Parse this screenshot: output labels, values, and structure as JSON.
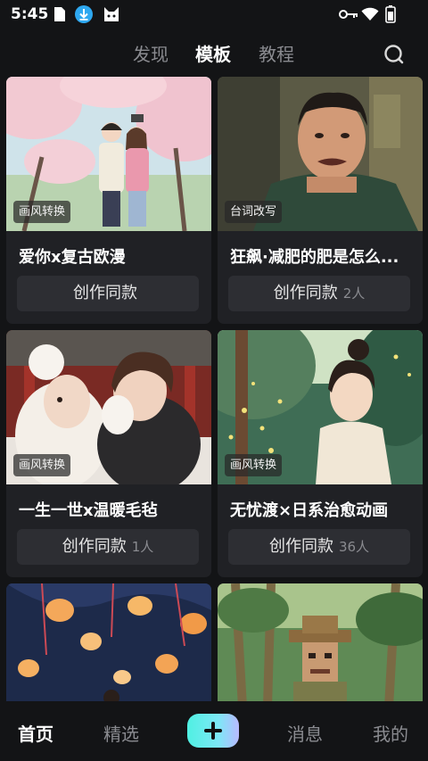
{
  "status_bar": {
    "time": "5:45",
    "left_icons": [
      "sim-card-icon",
      "download-icon",
      "cat-app-icon"
    ],
    "right_icons": [
      "key-icon",
      "wifi-icon",
      "battery-icon"
    ]
  },
  "top_tabs": [
    {
      "label": "发现",
      "active": false
    },
    {
      "label": "模板",
      "active": true
    },
    {
      "label": "教程",
      "active": false
    }
  ],
  "search_icon": "search-icon",
  "cards": [
    {
      "tag": "画风转换",
      "title": "爱你x复古欧漫",
      "button": "创作同款",
      "count": ""
    },
    {
      "tag": "台词改写",
      "title": "狂飙·减肥的肥是怎么...",
      "button": "创作同款",
      "count": "2人"
    },
    {
      "tag": "画风转换",
      "title": "一生一世x温暖毛毡",
      "button": "创作同款",
      "count": "1人"
    },
    {
      "tag": "画风转换",
      "title": "无忧渡×日系治愈动画",
      "button": "创作同款",
      "count": "36人"
    }
  ],
  "bottom_nav": {
    "items": [
      {
        "label": "首页",
        "active": true
      },
      {
        "label": "精选",
        "active": false
      },
      {
        "label": "消息",
        "active": false
      },
      {
        "label": "我的",
        "active": false
      }
    ],
    "create_icon": "plus-icon"
  },
  "colors": {
    "background": "#131416",
    "card": "#202125",
    "button": "#2d2e33",
    "create_gradient_start": "#4ff0e2",
    "create_gradient_end": "#b8b9ff"
  }
}
